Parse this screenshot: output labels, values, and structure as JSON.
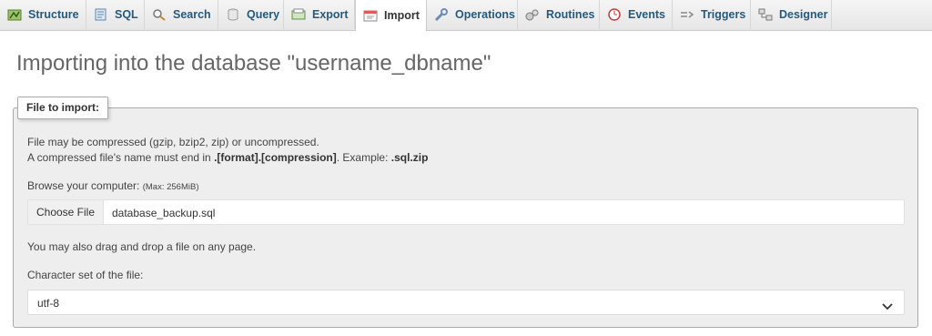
{
  "tabs": [
    {
      "label": "Structure",
      "icon": "structure-icon"
    },
    {
      "label": "SQL",
      "icon": "sql-icon"
    },
    {
      "label": "Search",
      "icon": "search-icon"
    },
    {
      "label": "Query",
      "icon": "query-icon"
    },
    {
      "label": "Export",
      "icon": "export-icon"
    },
    {
      "label": "Import",
      "icon": "import-icon",
      "active": true
    },
    {
      "label": "Operations",
      "icon": "wrench-icon"
    },
    {
      "label": "Routines",
      "icon": "routines-icon"
    },
    {
      "label": "Events",
      "icon": "clock-icon"
    },
    {
      "label": "Triggers",
      "icon": "triggers-icon"
    },
    {
      "label": "Designer",
      "icon": "designer-icon"
    }
  ],
  "page": {
    "title": "Importing into the database \"username_dbname\""
  },
  "file_section": {
    "legend": "File to import:",
    "compress_line1": "File may be compressed (gzip, bzip2, zip) or uncompressed.",
    "compress_line2_a": "A compressed file's name must end in ",
    "compress_line2_b": ".[format].[compression]",
    "compress_line2_c": ". Example: ",
    "compress_line2_d": ".sql.zip",
    "browse_label": "Browse your computer: ",
    "browse_max": "(Max: 256MiB)",
    "choose_file_label": "Choose File",
    "file_name": "database_backup.sql",
    "drag_drop_text": "You may also drag and drop a file on any page.",
    "charset_label": "Character set of the file:",
    "charset_value": "utf-8"
  },
  "colors": {
    "link": "#235a81",
    "panel": "#eeeeee"
  }
}
